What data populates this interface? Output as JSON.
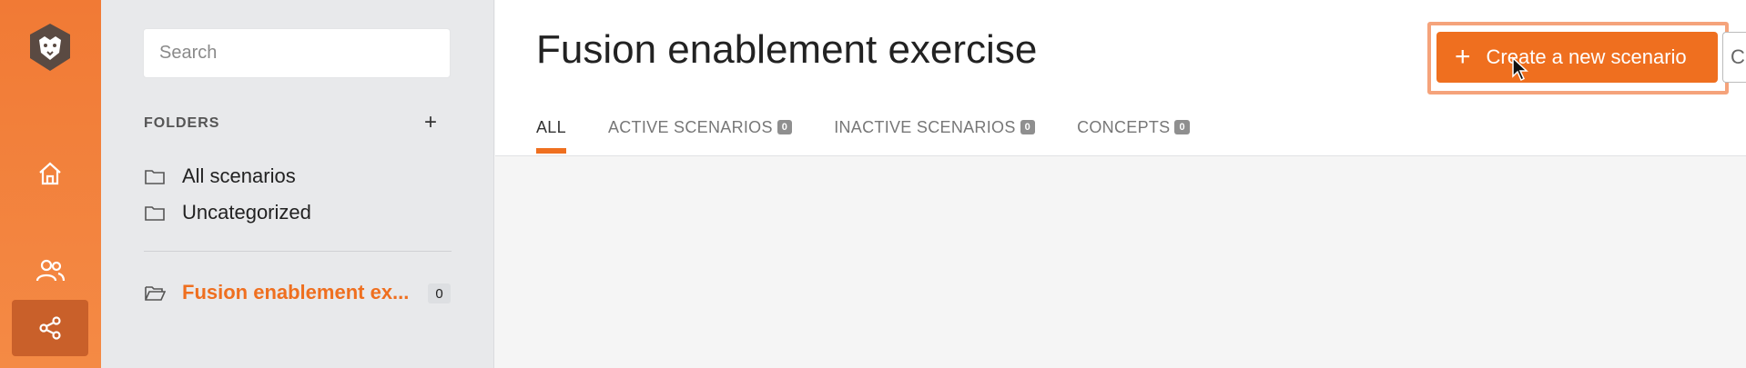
{
  "sidebar": {
    "search_placeholder": "Search",
    "folders_heading": "FOLDERS",
    "add_folder": "+",
    "folders": [
      {
        "label": "All scenarios"
      },
      {
        "label": "Uncategorized"
      }
    ],
    "current_folder": {
      "label": "Fusion enablement ex...",
      "count": "0"
    }
  },
  "main": {
    "title": "Fusion enablement exercise",
    "create_button": {
      "icon": "+",
      "label": "Create a new scenario"
    },
    "partial_button_label": "C",
    "tabs": [
      {
        "label": "ALL",
        "count": null
      },
      {
        "label": "ACTIVE SCENARIOS",
        "count": "0"
      },
      {
        "label": "INACTIVE SCENARIOS",
        "count": "0"
      },
      {
        "label": "CONCEPTS",
        "count": "0"
      }
    ]
  },
  "colors": {
    "accent": "#ef6f1f",
    "rail": "#f17a35",
    "highlight_border": "#f5a37b"
  },
  "icons": [
    "lion-logo-icon",
    "home-icon",
    "users-icon",
    "share-icon",
    "folder-icon",
    "folder-open-icon",
    "plus-icon",
    "cursor-icon"
  ]
}
